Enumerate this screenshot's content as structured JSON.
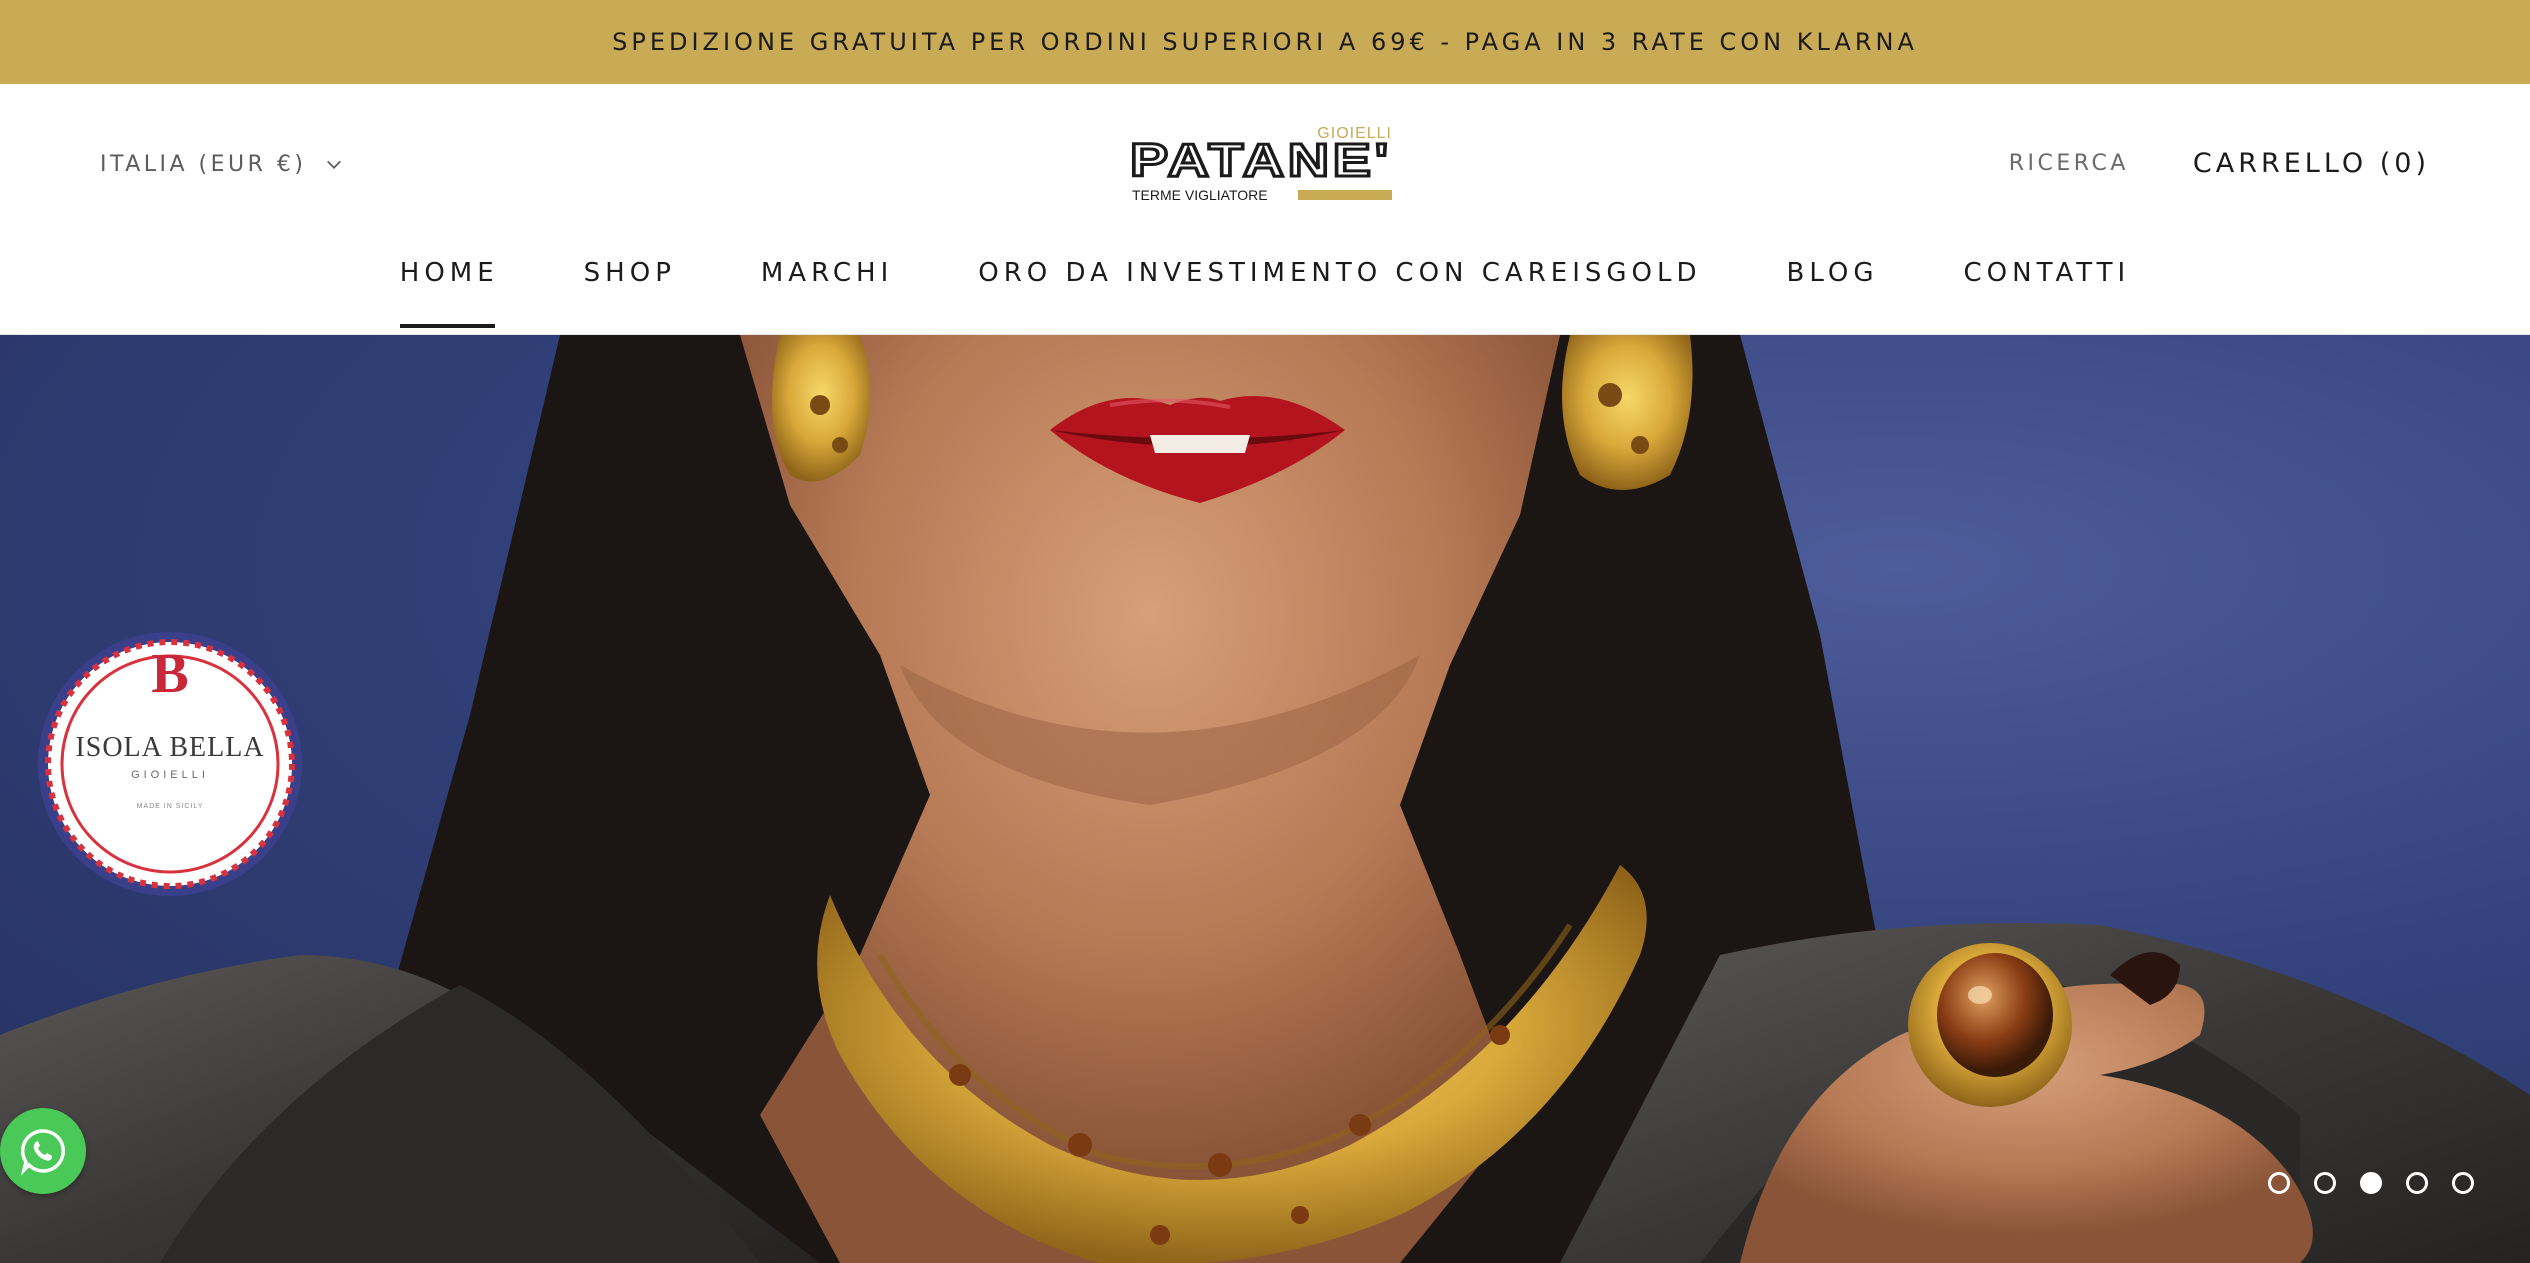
{
  "announcement": {
    "text": "SPEDIZIONE GRATUITA PER ORDINI SUPERIORI A 69€ - PAGA IN 3 RATE CON KLARNA"
  },
  "header": {
    "locale_label": "ITALIA (EUR €)",
    "logo": {
      "brand": "PATANE'",
      "top_text": "GIOIELLI",
      "sub_text": "TERME VIGLIATORE"
    },
    "search_label": "RICERCA",
    "cart_label": "CARRELLO (0)"
  },
  "nav": {
    "items": [
      {
        "label": "HOME",
        "active": true
      },
      {
        "label": "SHOP",
        "active": false
      },
      {
        "label": "MARCHI",
        "active": false
      },
      {
        "label": "ORO DA INVESTIMENTO CON CAREISGOLD",
        "active": false
      },
      {
        "label": "BLOG",
        "active": false
      },
      {
        "label": "CONTATTI",
        "active": false
      }
    ]
  },
  "hero": {
    "badge": {
      "title": "ISOLA BELLA",
      "subtitle": "GIOIELLI",
      "note": "MADE IN SICILY"
    },
    "slides_total": 5,
    "active_slide": 3
  },
  "colors": {
    "accent_gold": "#c9aa55",
    "hero_blue": "#33427c",
    "whatsapp_green": "#4ac959"
  },
  "icons": {
    "locale_chevron": "chevron-down-icon",
    "whatsapp": "whatsapp-icon"
  }
}
